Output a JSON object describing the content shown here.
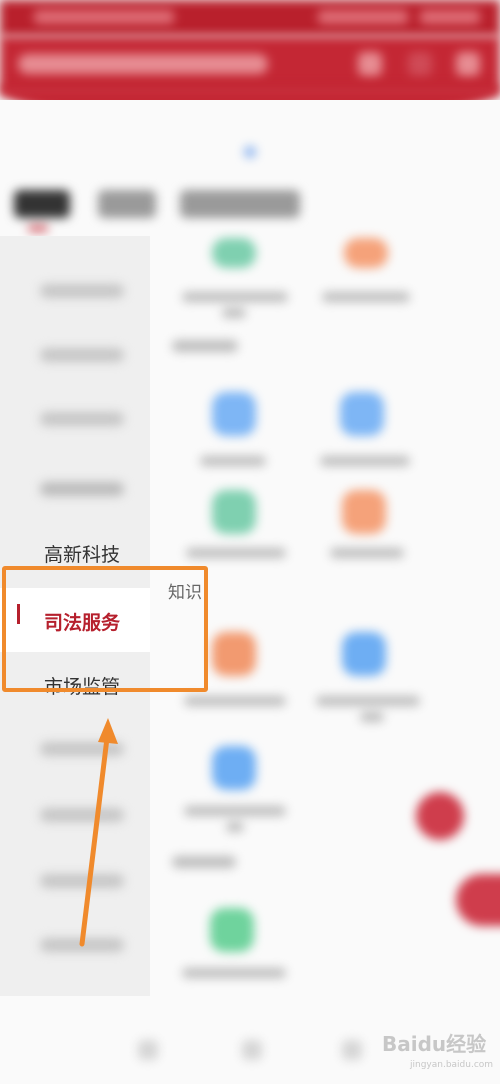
{
  "sidebar": {
    "items": [
      {
        "label": "高新科技",
        "active": false
      },
      {
        "label": "司法服务",
        "active": true
      },
      {
        "label": "市场监管",
        "active": false
      }
    ]
  },
  "main": {
    "section_partial_label": "知识"
  },
  "watermark": {
    "brand": "Baidu经验",
    "url": "jingyan.baidu.com"
  },
  "colors": {
    "brand_red": "#c42734",
    "active_text": "#b6202d",
    "highlight_orange": "#f08a2c"
  }
}
